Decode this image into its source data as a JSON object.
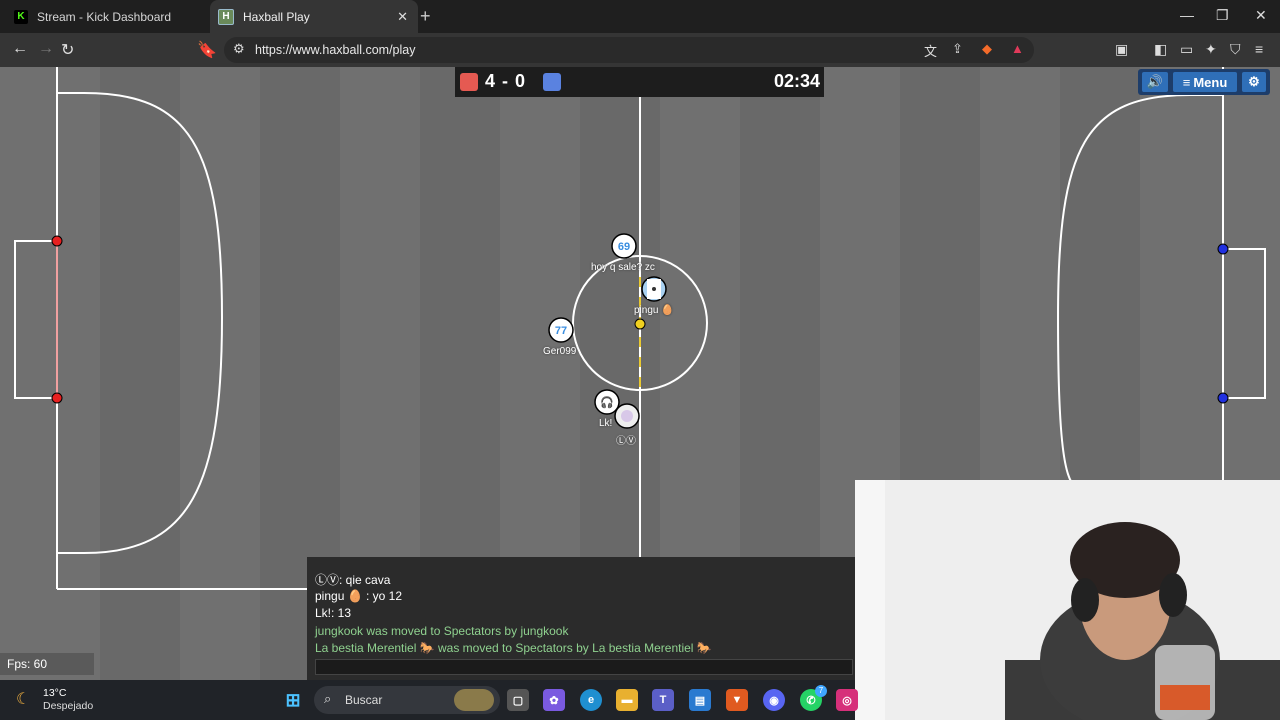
{
  "browser": {
    "tabs": [
      {
        "title": "Stream - Kick Dashboard",
        "favicon": "kick-icon"
      },
      {
        "title": "Haxball Play",
        "favicon": "haxball-icon",
        "active": true
      }
    ],
    "url": "https://www.haxball.com/play"
  },
  "game": {
    "score": "4 - 0",
    "time": "02:34",
    "colors": {
      "red": "#e55a52",
      "blue": "#5a82e0",
      "field": "#707070",
      "lines": "#ffffff"
    },
    "menu_label": "Menu",
    "players": [
      {
        "number": "69",
        "message": "hoy q sale? zc"
      },
      {
        "number": "77",
        "name": "Ger099"
      },
      {
        "name": "pingu 🥚"
      },
      {
        "name": "Lk!"
      },
      {
        "name": "ⓁⓋ"
      }
    ],
    "fps": "Fps: 60",
    "chat": [
      {
        "text": "ⓁⓋ: qie cava",
        "type": "player"
      },
      {
        "text": "pingu 🥚 : yo 12",
        "type": "player"
      },
      {
        "text": "Lk!: 13",
        "type": "player"
      },
      {
        "text": "jungkook was moved to Spectators by jungkook",
        "type": "system"
      },
      {
        "text": "La bestia Merentiel 🐎 was moved to Spectators by La bestia Merentiel 🐎",
        "type": "system"
      }
    ]
  },
  "taskbar": {
    "weather_temp": "13°C",
    "weather_desc": "Despejado",
    "search_placeholder": "Buscar",
    "whatsapp_badge": "7"
  }
}
